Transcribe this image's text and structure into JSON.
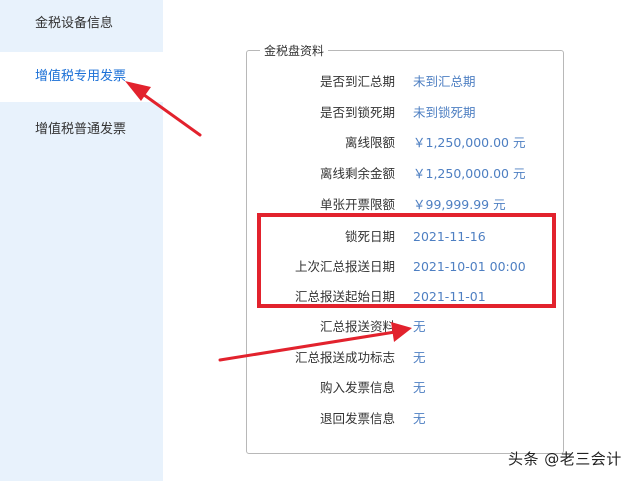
{
  "sidebar": {
    "items": [
      {
        "label": "金税设备信息"
      },
      {
        "label": "增值税专用发票"
      },
      {
        "label": "增值税普通发票"
      }
    ]
  },
  "panel": {
    "legend": "金税盘资料",
    "rows": [
      {
        "label": "是否到汇总期",
        "value": "未到汇总期"
      },
      {
        "label": "是否到锁死期",
        "value": "未到锁死期"
      },
      {
        "label": "离线限额",
        "value": "￥1,250,000.00 元"
      },
      {
        "label": "离线剩余金额",
        "value": "￥1,250,000.00 元"
      },
      {
        "label": "单张开票限额",
        "value": "￥99,999.99 元"
      },
      {
        "label": "锁死日期",
        "value": "2021-11-16"
      },
      {
        "label": "上次汇总报送日期",
        "value": "2021-10-01 00:00"
      },
      {
        "label": "汇总报送起始日期",
        "value": "2021-11-01"
      },
      {
        "label": "汇总报送资料",
        "value": "无"
      },
      {
        "label": "汇总报送成功标志",
        "value": "无"
      },
      {
        "label": "购入发票信息",
        "value": "无"
      },
      {
        "label": "退回发票信息",
        "value": "无"
      }
    ]
  },
  "watermark": "头条 @老三会计",
  "colors": {
    "sidebar_bg": "#e8f2fc",
    "active_text": "#1a6fd6",
    "value_text": "#4e7fc2",
    "annotation_red": "#e2222d"
  }
}
